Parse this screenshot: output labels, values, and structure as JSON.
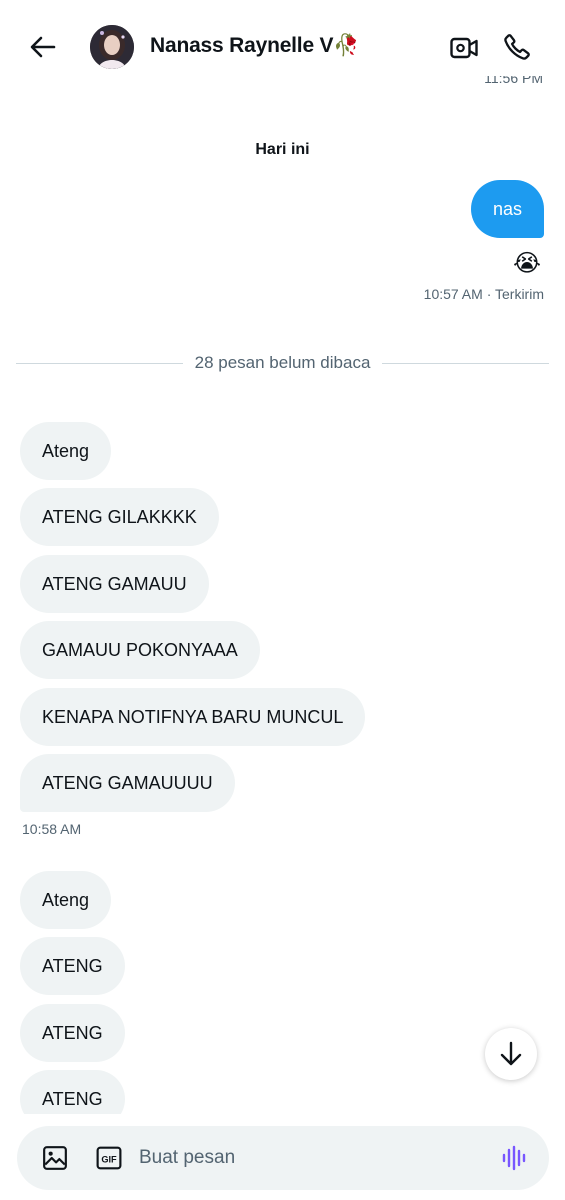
{
  "header": {
    "contact_name": "Nanass Raynelle V🥀",
    "back_icon": "arrow-left-icon",
    "video_icon": "video-camera-icon",
    "call_icon": "phone-icon"
  },
  "previous_timestamp": "11:56 PM",
  "day_separator": "Hari ini",
  "outgoing": {
    "text": "nas",
    "reaction": "😭",
    "status": "10:57 AM · Terkirim",
    "color": "#1d9bf0"
  },
  "unread_divider": "28 pesan belum dibaca",
  "incoming_group_1": {
    "messages": [
      "Ateng",
      "ATENG GILAKKKK",
      "ATENG GAMAUU",
      "GAMAUU POKONYAAA",
      "KENAPA NOTIFNYA BARU MUNCUL",
      "ATENG GAMAUUUU"
    ],
    "time": "10:58 AM"
  },
  "incoming_group_2": {
    "messages": [
      "Ateng",
      "ATENG",
      "ATENG",
      "ATENG"
    ]
  },
  "composer": {
    "placeholder": "Buat pesan",
    "image_icon": "image-icon",
    "gif_label": "GIF",
    "voice_icon": "voice-wave-icon",
    "voice_color": "#7856ff"
  },
  "scroll_down_icon": "arrow-down-icon"
}
